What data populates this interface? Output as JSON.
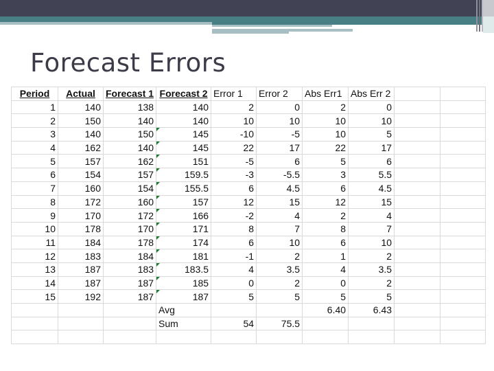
{
  "slide": {
    "title": "Forecast Errors",
    "colors": {
      "header_dark": "#414354",
      "header_teal": "#477f84",
      "header_light": "#a7bfc2",
      "title_text": "#3b3c48",
      "grid_line": "#d9d9d9",
      "error_flag": "#1e7a33"
    }
  },
  "table": {
    "headers": [
      "Period",
      "Actual",
      "Forecast 1",
      "Forecast 2",
      "Error 1",
      "Error 2",
      "Abs Err1",
      "Abs Err 2",
      "",
      ""
    ],
    "rows": [
      {
        "period": "1",
        "actual": "140",
        "f1": "138",
        "f2": "140",
        "e1": "2",
        "e2": "0",
        "ae1": "2",
        "ae2": "0",
        "flag": false
      },
      {
        "period": "2",
        "actual": "150",
        "f1": "140",
        "f2": "140",
        "e1": "10",
        "e2": "10",
        "ae1": "10",
        "ae2": "10",
        "flag": false
      },
      {
        "period": "3",
        "actual": "140",
        "f1": "150",
        "f2": "145",
        "e1": "-10",
        "e2": "-5",
        "ae1": "10",
        "ae2": "5",
        "flag": true
      },
      {
        "period": "4",
        "actual": "162",
        "f1": "140",
        "f2": "145",
        "e1": "22",
        "e2": "17",
        "ae1": "22",
        "ae2": "17",
        "flag": true
      },
      {
        "period": "5",
        "actual": "157",
        "f1": "162",
        "f2": "151",
        "e1": "-5",
        "e2": "6",
        "ae1": "5",
        "ae2": "6",
        "flag": true
      },
      {
        "period": "6",
        "actual": "154",
        "f1": "157",
        "f2": "159.5",
        "e1": "-3",
        "e2": "-5.5",
        "ae1": "3",
        "ae2": "5.5",
        "flag": true
      },
      {
        "period": "7",
        "actual": "160",
        "f1": "154",
        "f2": "155.5",
        "e1": "6",
        "e2": "4.5",
        "ae1": "6",
        "ae2": "4.5",
        "flag": true
      },
      {
        "period": "8",
        "actual": "172",
        "f1": "160",
        "f2": "157",
        "e1": "12",
        "e2": "15",
        "ae1": "12",
        "ae2": "15",
        "flag": true
      },
      {
        "period": "9",
        "actual": "170",
        "f1": "172",
        "f2": "166",
        "e1": "-2",
        "e2": "4",
        "ae1": "2",
        "ae2": "4",
        "flag": true
      },
      {
        "period": "10",
        "actual": "178",
        "f1": "170",
        "f2": "171",
        "e1": "8",
        "e2": "7",
        "ae1": "8",
        "ae2": "7",
        "flag": true
      },
      {
        "period": "11",
        "actual": "184",
        "f1": "178",
        "f2": "174",
        "e1": "6",
        "e2": "10",
        "ae1": "6",
        "ae2": "10",
        "flag": true
      },
      {
        "period": "12",
        "actual": "183",
        "f1": "184",
        "f2": "181",
        "e1": "-1",
        "e2": "2",
        "ae1": "1",
        "ae2": "2",
        "flag": true
      },
      {
        "period": "13",
        "actual": "187",
        "f1": "183",
        "f2": "183.5",
        "e1": "4",
        "e2": "3.5",
        "ae1": "4",
        "ae2": "3.5",
        "flag": true
      },
      {
        "period": "14",
        "actual": "187",
        "f1": "187",
        "f2": "185",
        "e1": "0",
        "e2": "2",
        "ae1": "0",
        "ae2": "2",
        "flag": true
      },
      {
        "period": "15",
        "actual": "192",
        "f1": "187",
        "f2": "187",
        "e1": "5",
        "e2": "5",
        "ae1": "5",
        "ae2": "5",
        "flag": true
      }
    ],
    "summary": {
      "avg_label": "Avg",
      "avg_abs_err1": "6.40",
      "avg_abs_err2": "6.43",
      "sum_label": "Sum",
      "sum_error1": "54",
      "sum_error2": "75.5"
    }
  }
}
